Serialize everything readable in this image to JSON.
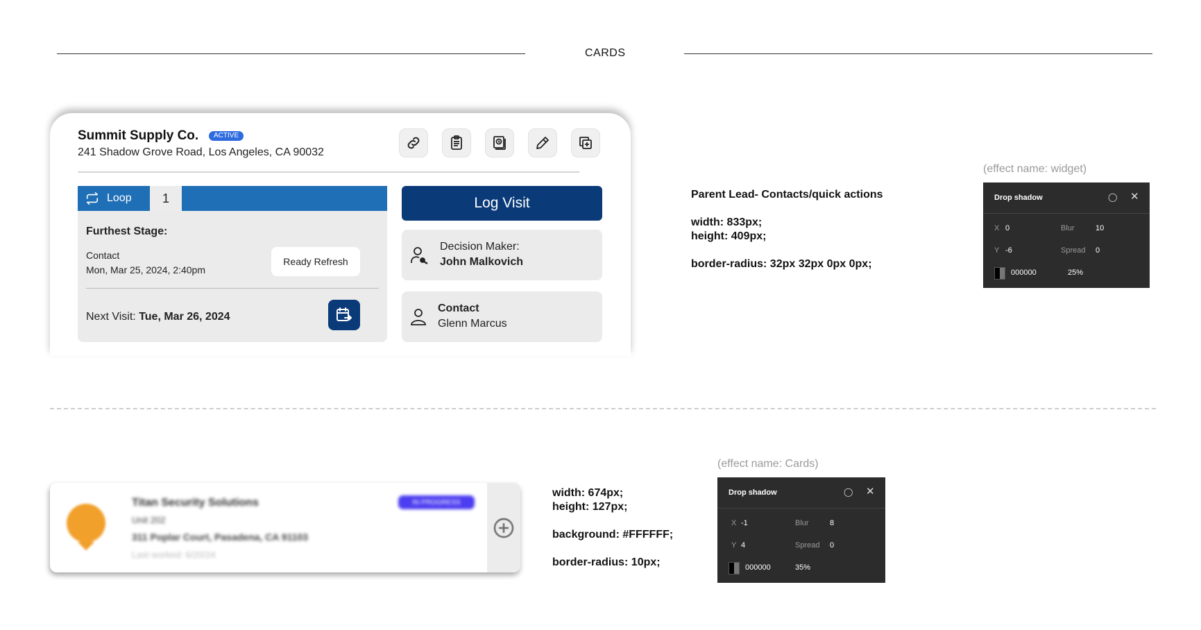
{
  "section": {
    "title": "CARDS"
  },
  "big_card": {
    "company": "Summit Supply Co.",
    "status_badge": "ACTIVE",
    "address": "241 Shadow Grove Road, Los Angeles, CA 90032",
    "action_icons": [
      "link-icon",
      "clipboard-icon",
      "history-report-icon",
      "pencil-icon",
      "duplicate-icon"
    ],
    "loop_label": "Loop",
    "loop_count": "1",
    "furthest_stage_label": "Furthest Stage:",
    "stage_name": "Contact",
    "stage_datetime": "Mon, Mar 25, 2024, 2:40pm",
    "ready_refresh_label": "Ready Refresh",
    "next_visit_label": "Next Visit:",
    "next_visit_date": "Tue, Mar 26, 2024",
    "log_visit_label": "Log Visit",
    "decision_maker_role": "Decision Maker:",
    "decision_maker_name": "John Malkovich",
    "contact_role": "Contact",
    "contact_name": "Glenn Marcus"
  },
  "spec_big": {
    "title": "Parent Lead- Contacts/quick actions",
    "width": "width: 833px;",
    "height": "height: 409px;",
    "radius": "border-radius: 32px 32px 0px 0px;",
    "effect_name": "(effect name: widget)",
    "panel": {
      "title": "Drop shadow",
      "x_label": "X",
      "x_value": "0",
      "y_label": "Y",
      "y_value": "-6",
      "blur_label": "Blur",
      "blur_value": "10",
      "spread_label": "Spread",
      "spread_value": "0",
      "color": "000000",
      "opacity": "25%"
    }
  },
  "small_card": {
    "title": "Titan Security Solutions",
    "badge": "IN PROGRESS",
    "unit": "Unit 202",
    "address": "311 Poplar Court, Pasadena, CA 91103",
    "last_worked": "Last worked: 6/20/24",
    "accent_color": "#f1a02b"
  },
  "spec_small": {
    "width": "width: 674px;",
    "height": "height: 127px;",
    "background": "background: #FFFFFF;",
    "radius": "border-radius: 10px;",
    "effect_name": "(effect name: Cards)",
    "panel": {
      "title": "Drop shadow",
      "x_label": "X",
      "x_value": "-1",
      "y_label": "Y",
      "y_value": "4",
      "blur_label": "Blur",
      "blur_value": "8",
      "spread_label": "Spread",
      "spread_value": "0",
      "color": "000000",
      "opacity": "35%"
    }
  },
  "colors": {
    "primary": "#0a3a78",
    "loop_blue": "#1f6fb6",
    "active_badge": "#2e6bdf"
  }
}
